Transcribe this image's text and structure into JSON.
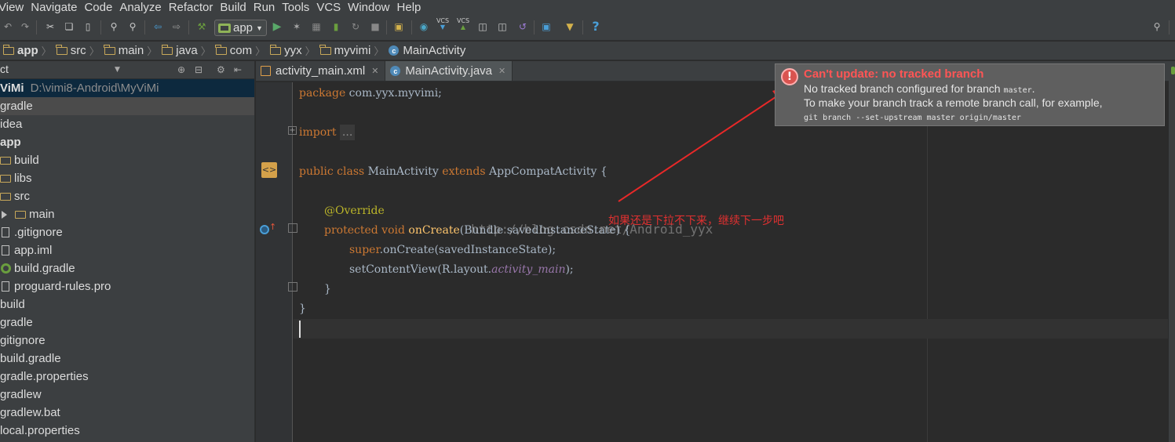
{
  "menu": [
    "View",
    "Navigate",
    "Code",
    "Analyze",
    "Refactor",
    "Build",
    "Run",
    "Tools",
    "VCS",
    "Window",
    "Help"
  ],
  "toolbar": {
    "run_config": "app",
    "vcs_label": "VCS",
    "help_glyph": "?"
  },
  "breadcrumb": [
    "app",
    "src",
    "main",
    "java",
    "com",
    "yyx",
    "myvimi",
    "MainActivity"
  ],
  "project": {
    "header_label": "ct",
    "root_name": "ViMi",
    "root_path": "D:\\vimi8-Android\\MyViMi",
    "items": [
      {
        "label": "gradle",
        "kind": "plain",
        "indent": 0,
        "selected": true
      },
      {
        "label": "idea",
        "kind": "plain",
        "indent": 0
      },
      {
        "label": "app",
        "kind": "plain-bold",
        "indent": 0
      },
      {
        "label": "build",
        "kind": "folder",
        "indent": 1
      },
      {
        "label": "libs",
        "kind": "folder",
        "indent": 1
      },
      {
        "label": "src",
        "kind": "folder",
        "indent": 1
      },
      {
        "label": "main",
        "kind": "expand-folder",
        "indent": 1
      },
      {
        "label": ".gitignore",
        "kind": "file",
        "indent": 1
      },
      {
        "label": "app.iml",
        "kind": "file",
        "indent": 1
      },
      {
        "label": "build.gradle",
        "kind": "gradle",
        "indent": 1
      },
      {
        "label": "proguard-rules.pro",
        "kind": "file",
        "indent": 1
      },
      {
        "label": "build",
        "kind": "plain",
        "indent": 0
      },
      {
        "label": "gradle",
        "kind": "plain",
        "indent": 0
      },
      {
        "label": "gitignore",
        "kind": "plain",
        "indent": 0
      },
      {
        "label": "build.gradle",
        "kind": "plain",
        "indent": 0
      },
      {
        "label": "gradle.properties",
        "kind": "plain",
        "indent": 0
      },
      {
        "label": "gradlew",
        "kind": "plain",
        "indent": 0
      },
      {
        "label": "gradlew.bat",
        "kind": "plain",
        "indent": 0
      },
      {
        "label": "local.properties",
        "kind": "plain",
        "indent": 0
      }
    ]
  },
  "tabs": [
    {
      "label": "activity_main.xml",
      "icon": "xml-file-icon",
      "active": false
    },
    {
      "label": "MainActivity.java",
      "icon": "java-class-icon",
      "active": true
    }
  ],
  "code": {
    "package_kw": "package",
    "package_name": " com.yyx.myvimi;",
    "import_kw": "import",
    "import_fold": "...",
    "class_line": {
      "kw1": "public class",
      "name": " MainActivity ",
      "kw2": "extends",
      "rest": " AppCompatActivity {"
    },
    "override": "@Override",
    "oncreate": {
      "kw": "protected void",
      "fn": " onCreate",
      "rest": "(Bundle savedInstanceState) {"
    },
    "super_line": {
      "kw": "super",
      "rest": ".onCreate(savedInstanceState);"
    },
    "setcontent": {
      "a": "setContentView(R.layout.",
      "it": "activity_main",
      "b": ");"
    },
    "close1": "}",
    "close2": "}"
  },
  "watermark": "http://blog.csdn.net/Android_yyx",
  "annotation": "如果还是下拉不下来，继续下一步吧",
  "notification": {
    "title": "Can't update: no tracked branch",
    "line1a": "No tracked branch configured for branch ",
    "line1b": "master",
    "line1c": ".",
    "line2": "To make your branch track a remote branch call, for example,",
    "line3": "git branch --set-upstream master origin/master"
  },
  "colors": {
    "accent": "#cc7832",
    "error": "#ff5555",
    "annotation": "#e03030"
  }
}
